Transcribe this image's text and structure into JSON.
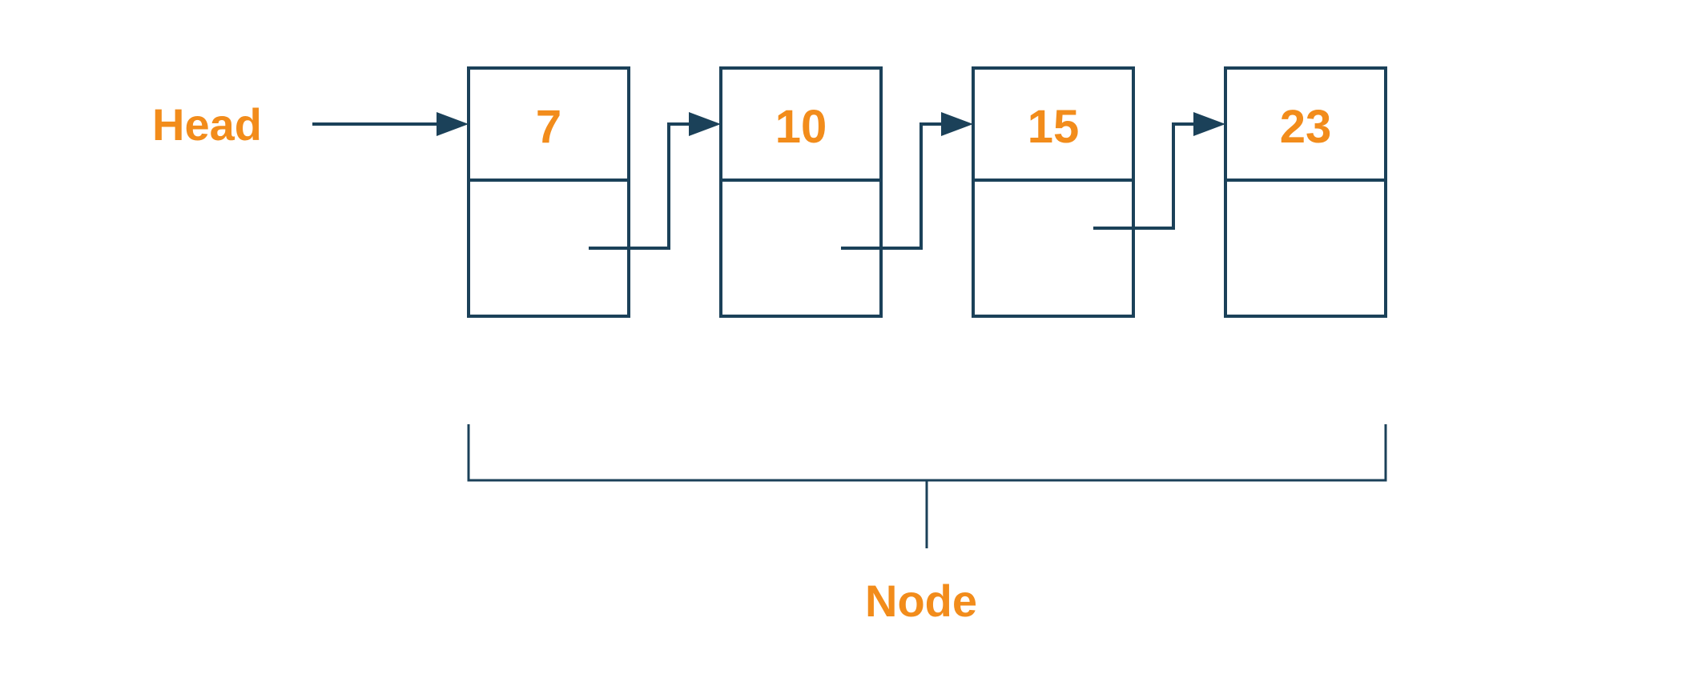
{
  "diagram": {
    "head_label": "Head",
    "node_label": "Node",
    "nodes": [
      {
        "value": "7"
      },
      {
        "value": "10"
      },
      {
        "value": "15"
      },
      {
        "value": "23"
      }
    ],
    "colors": {
      "stroke": "#1b4159",
      "accent": "#f28c1b"
    }
  }
}
